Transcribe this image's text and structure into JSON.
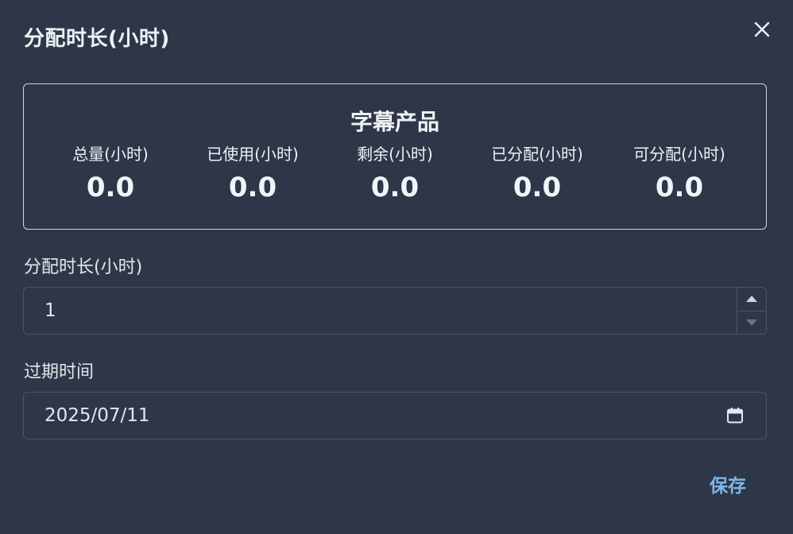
{
  "dialog": {
    "title": "分配时长(小时)",
    "close_icon": "close-icon"
  },
  "summary": {
    "title": "字幕产品",
    "stats": [
      {
        "label": "总量(小时)",
        "value": "0.0"
      },
      {
        "label": "已使用(小时)",
        "value": "0.0"
      },
      {
        "label": "剩余(小时)",
        "value": "0.0"
      },
      {
        "label": "已分配(小时)",
        "value": "0.0"
      },
      {
        "label": "可分配(小时)",
        "value": "0.0"
      }
    ]
  },
  "form": {
    "duration": {
      "label": "分配时长(小时)",
      "value": "1",
      "icons": [
        "chevron-up-icon",
        "chevron-down-icon"
      ]
    },
    "expiry": {
      "label": "过期时间",
      "value": "2025/07/11",
      "icon": "calendar-icon"
    }
  },
  "actions": {
    "save_label": "保存"
  },
  "colors": {
    "background": "#2d3748",
    "accent": "#7bb8e8"
  }
}
